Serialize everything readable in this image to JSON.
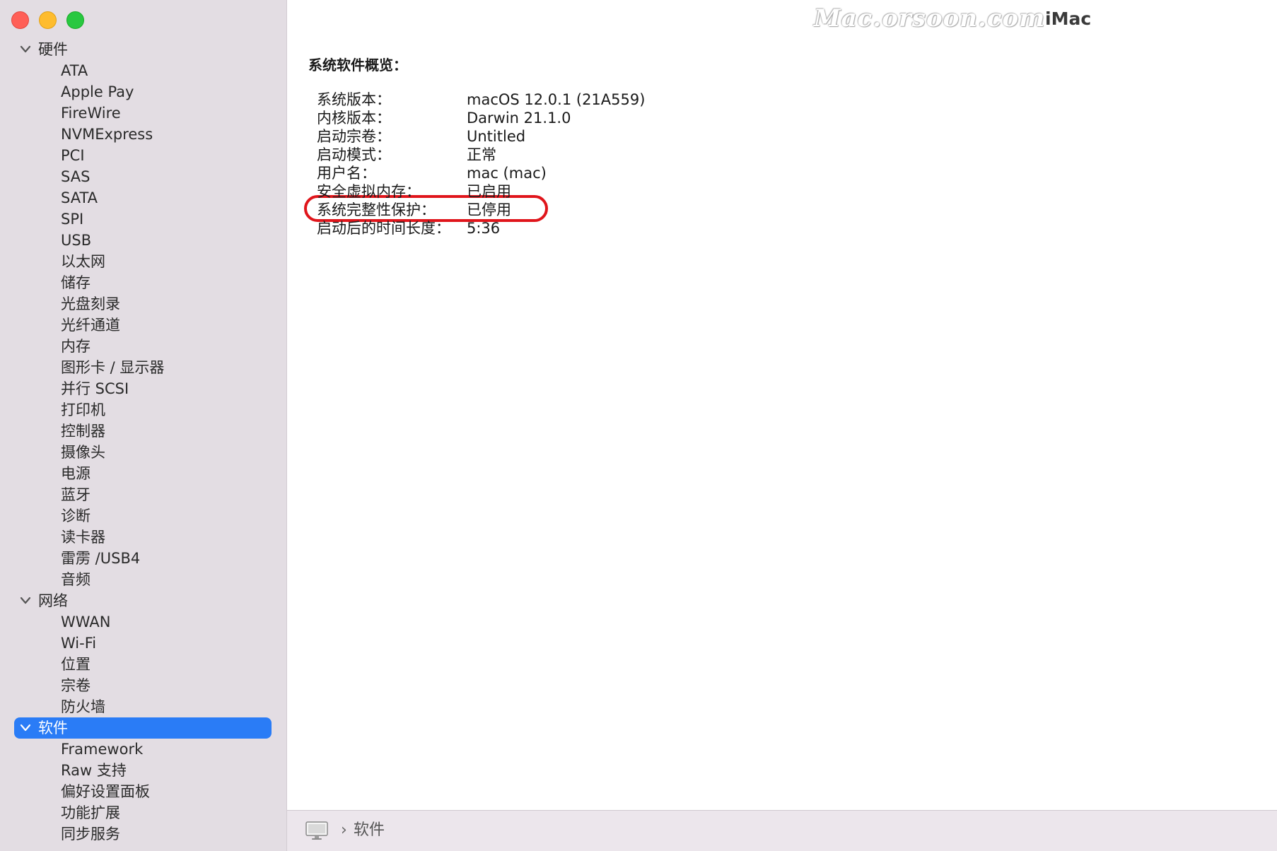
{
  "window": {
    "title": "iMac",
    "watermark": "Mac.orsoon.com"
  },
  "sidebar": {
    "groups": [
      {
        "label": "硬件",
        "expanded": true,
        "items": [
          "ATA",
          "Apple Pay",
          "FireWire",
          "NVMExpress",
          "PCI",
          "SAS",
          "SATA",
          "SPI",
          "USB",
          "以太网",
          "储存",
          "光盘刻录",
          "光纤通道",
          "内存",
          "图形卡 / 显示器",
          "并行 SCSI",
          "打印机",
          "控制器",
          "摄像头",
          "电源",
          "蓝牙",
          "诊断",
          "读卡器",
          "雷雳 /USB4",
          "音频"
        ]
      },
      {
        "label": "网络",
        "expanded": true,
        "items": [
          "WWAN",
          "Wi-Fi",
          "位置",
          "宗卷",
          "防火墙"
        ]
      },
      {
        "label": "软件",
        "expanded": true,
        "selected": true,
        "items": [
          "Framework",
          "Raw 支持",
          "偏好设置面板",
          "功能扩展",
          "同步服务"
        ]
      }
    ]
  },
  "content": {
    "section_title": "系统软件概览：",
    "rows": [
      {
        "label": "系统版本：",
        "value": "macOS 12.0.1 (21A559)"
      },
      {
        "label": "内核版本：",
        "value": "Darwin 21.1.0"
      },
      {
        "label": "启动宗卷：",
        "value": "Untitled"
      },
      {
        "label": "启动模式：",
        "value": "正常"
      },
      {
        "label": "用户名：",
        "value": "mac (mac)"
      },
      {
        "label": "安全虚拟内存：",
        "value": "已启用"
      },
      {
        "label": "系统完整性保护：",
        "value": "已停用",
        "highlighted": true
      },
      {
        "label": "启动后的时间长度：",
        "value": "5:36"
      }
    ],
    "highlight_color": "#e0151b"
  },
  "pathbar": {
    "icon": "computer-icon",
    "separator": "›",
    "label": "软件"
  },
  "colors": {
    "sidebar_bg": "#e3dde3",
    "selection": "#2a7cf6",
    "close": "#ff5f57",
    "minimize": "#febc2e",
    "zoom": "#28c840"
  }
}
